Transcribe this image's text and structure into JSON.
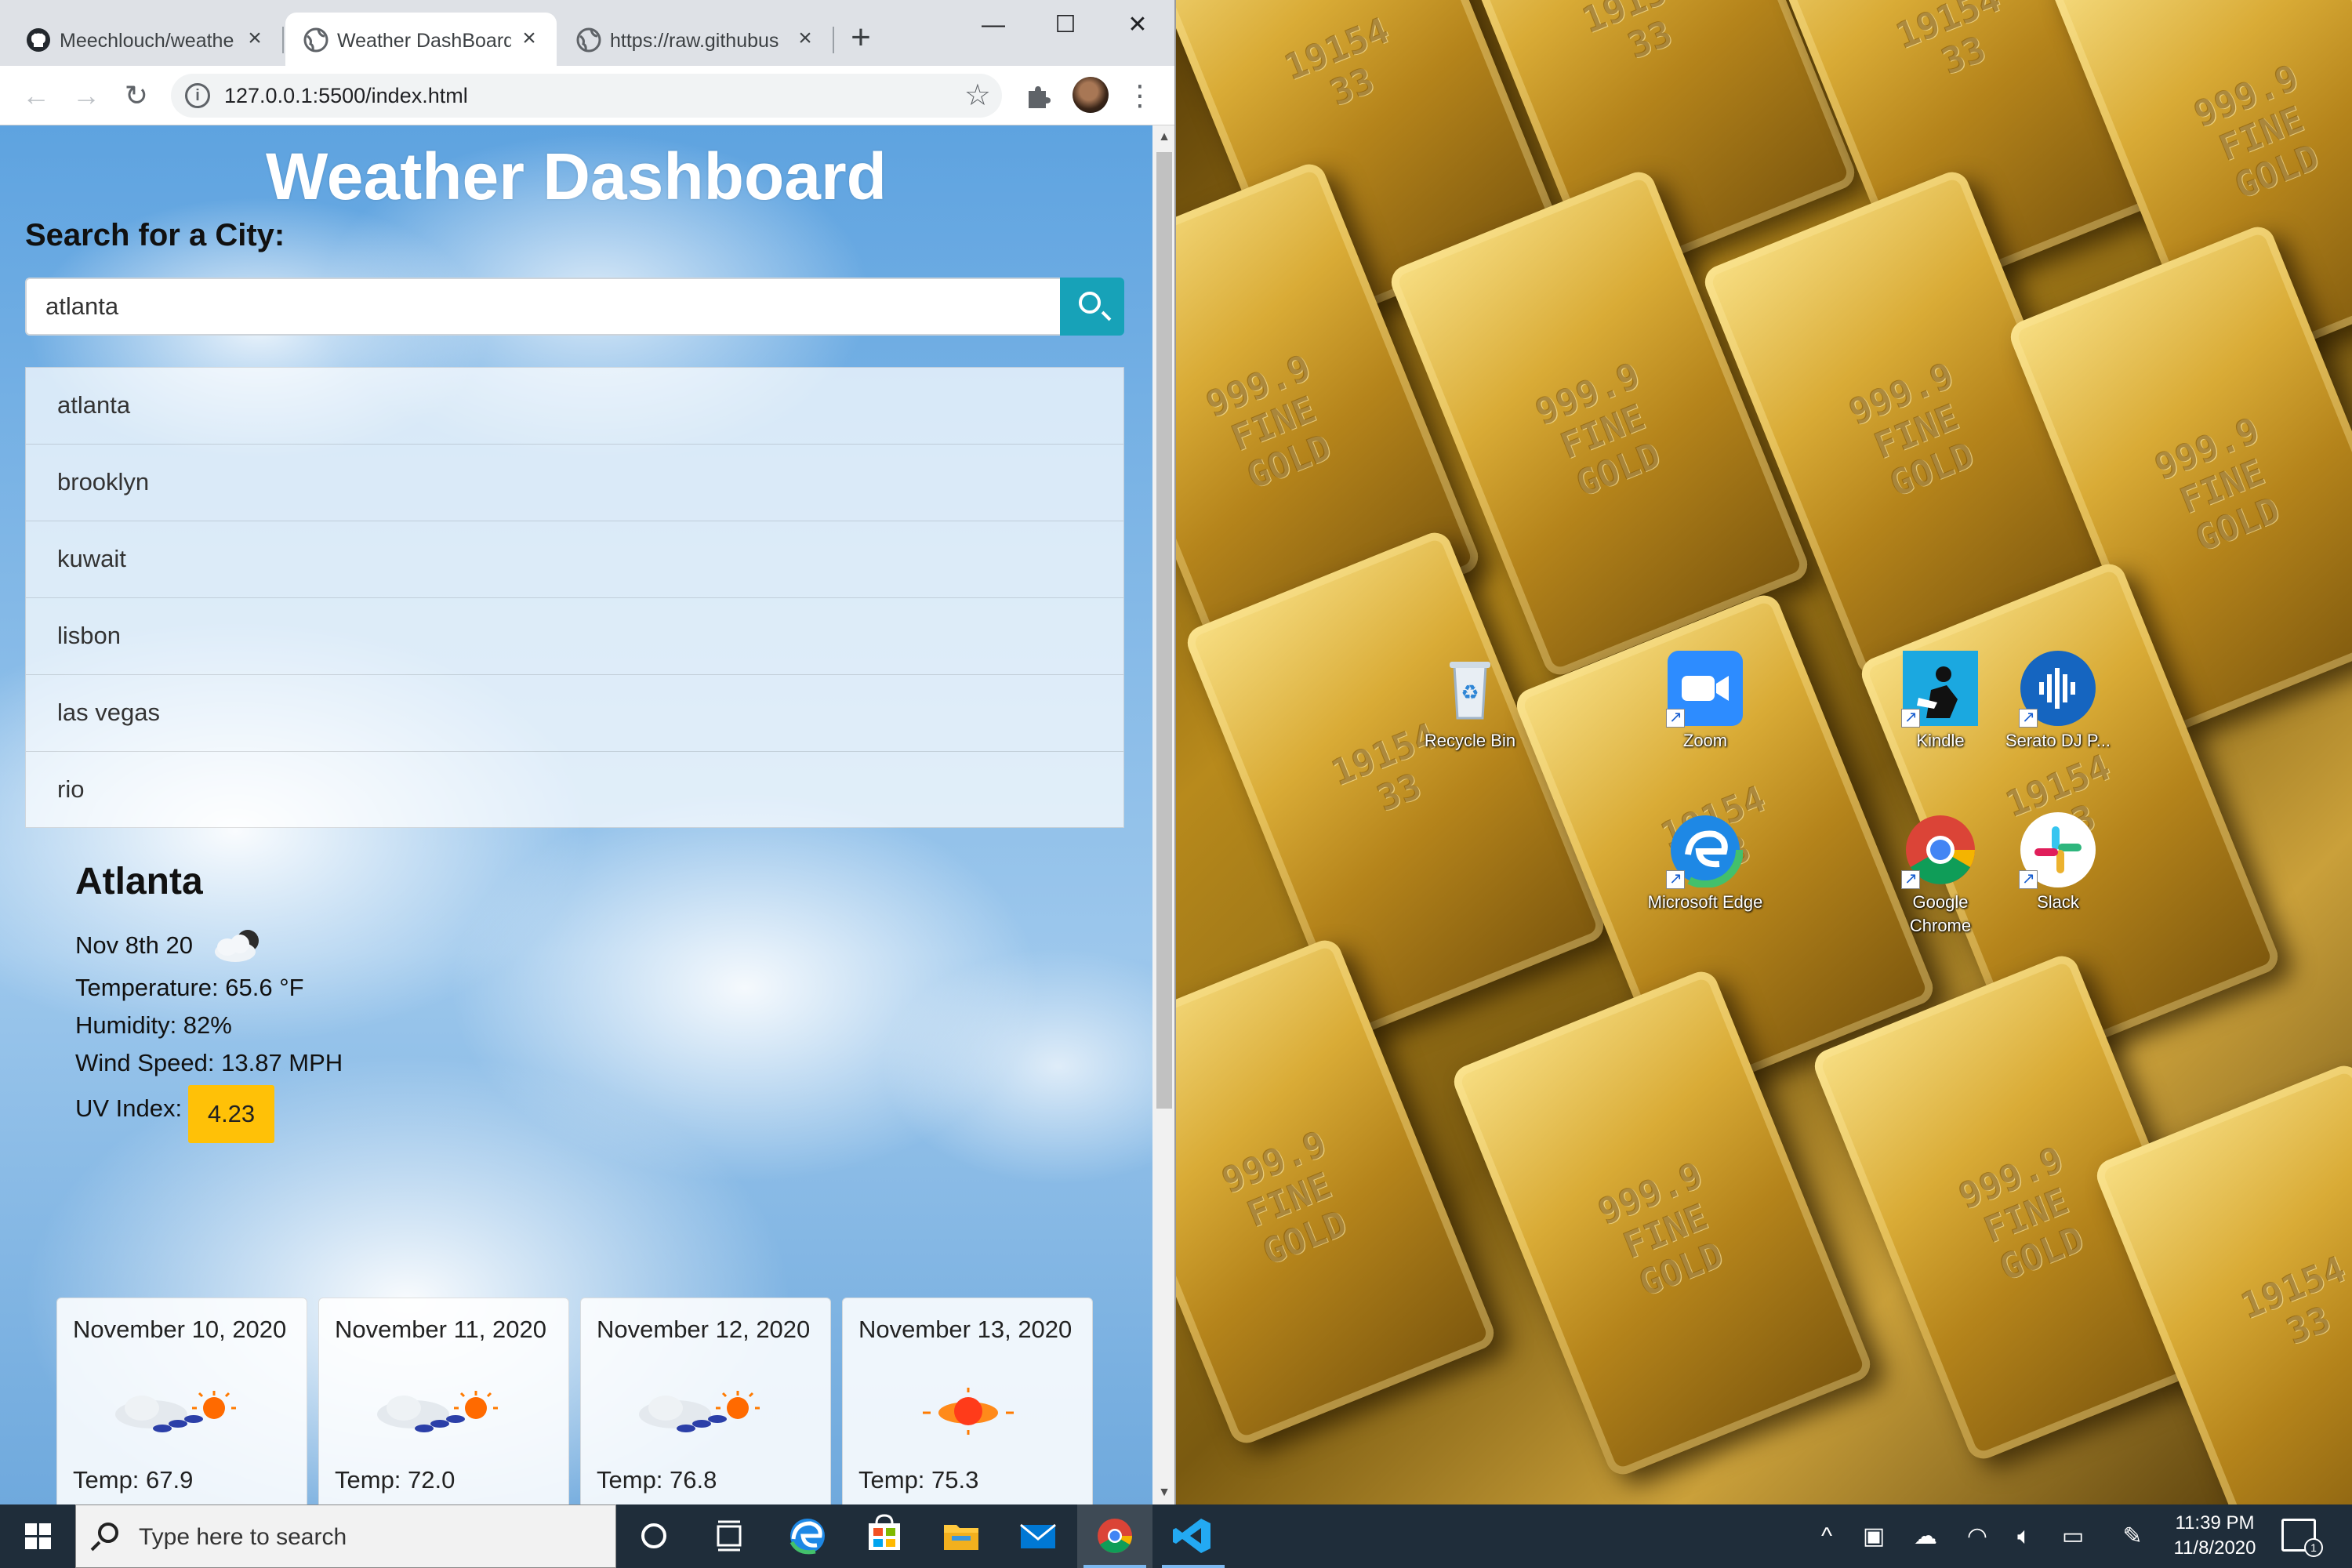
{
  "browser": {
    "tabs": [
      {
        "title": "Meechlouch/weathe",
        "favicon": "github-icon",
        "active": false
      },
      {
        "title": "Weather DashBoard",
        "favicon": "globe-icon",
        "active": true
      },
      {
        "title": "https://raw.githubus",
        "favicon": "globe-icon",
        "active": false
      }
    ],
    "url": "127.0.0.1:5500/index.html",
    "new_tab_glyph": "+",
    "window_controls": {
      "minimize": "—",
      "maximize": "☐",
      "close": "✕"
    }
  },
  "page": {
    "title": "Weather Dashboard",
    "search_label": "Search for a City:",
    "search_value": "atlanta",
    "history": [
      "atlanta",
      "brooklyn",
      "kuwait",
      "lisbon",
      "las vegas",
      "rio"
    ],
    "current": {
      "city": "Atlanta",
      "date": "Nov 8th 20",
      "icon": "partly-cloudy-night-icon",
      "temperature": "Temperature: 65.6 °F",
      "humidity": "Humidity: 82%",
      "wind": "Wind Speed: 13.87 MPH",
      "uv_label": "UV Index:",
      "uv_value": "4.23",
      "uv_color": "#ffc107"
    },
    "forecast": [
      {
        "date": "November 10, 2020",
        "icon": "rain-sun-icon",
        "temp": "Temp: 67.9"
      },
      {
        "date": "November 11, 2020",
        "icon": "rain-sun-icon",
        "temp": "Temp: 72.0"
      },
      {
        "date": "November 12, 2020",
        "icon": "rain-sun-icon",
        "temp": "Temp: 76.8"
      },
      {
        "date": "November 13, 2020",
        "icon": "sun-icon",
        "temp": "Temp: 75.3"
      }
    ]
  },
  "desktop": {
    "icons": [
      {
        "label": "Recycle Bin",
        "icon": "recycle-bin-icon"
      },
      {
        "label": "Zoom",
        "icon": "zoom-icon"
      },
      {
        "label": "Kindle",
        "icon": "kindle-icon"
      },
      {
        "label": "Serato DJ P...",
        "icon": "serato-icon"
      },
      {
        "label": "Microsoft Edge",
        "icon": "edge-icon"
      },
      {
        "label": "Google Chrome",
        "icon": "chrome-icon"
      },
      {
        "label": "Slack",
        "icon": "slack-icon"
      }
    ],
    "bar_stamps": [
      "999.9\nFINE\nGOLD",
      "19154\n33"
    ]
  },
  "taskbar": {
    "search_placeholder": "Type here to search",
    "time": "11:39 PM",
    "date": "11/8/2020",
    "notification_count": "1",
    "apps": [
      "cortana-icon",
      "task-view-icon",
      "edge-icon",
      "store-icon",
      "file-explorer-icon",
      "mail-icon",
      "chrome-icon",
      "vscode-icon"
    ]
  },
  "colors": {
    "accent": "#17a2b8",
    "uv": "#ffc107",
    "taskbar": "#1f2d3a"
  }
}
